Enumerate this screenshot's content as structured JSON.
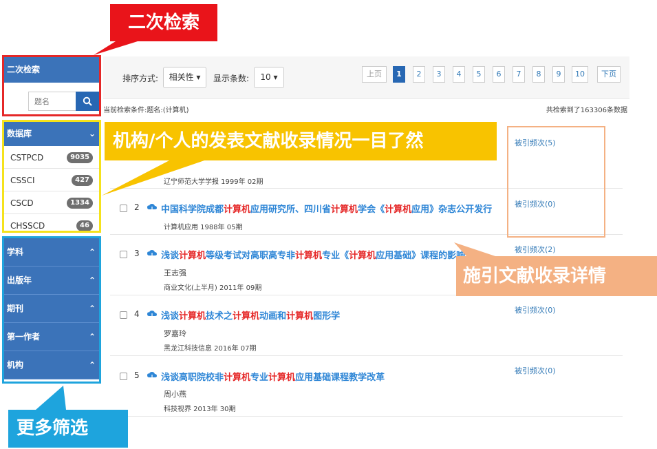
{
  "sidebar": {
    "advanced_search_title": "二次检索",
    "search_placeholder": "题名",
    "database_title": "数据库",
    "databases": [
      {
        "name": "CSTPCD",
        "count": "9035"
      },
      {
        "name": "CSSCI",
        "count": "427"
      },
      {
        "name": "CSCD",
        "count": "1334"
      },
      {
        "name": "CHSSCD",
        "count": "46"
      }
    ],
    "filters": [
      "学科",
      "出版年",
      "期刊",
      "第一作者",
      "机构"
    ]
  },
  "toolbar": {
    "sort_label": "排序方式:",
    "sort_value": "相关性",
    "display_label": "显示条数:",
    "display_value": "10",
    "prev": "上页",
    "pages": [
      "1",
      "2",
      "3",
      "4",
      "5",
      "6",
      "7",
      "8",
      "9",
      "10"
    ],
    "next": "下页"
  },
  "conditions": "当前检索条件:题名:(计算机)",
  "total": "共检索到了163306条数据",
  "results": [
    {
      "num": "",
      "title": "",
      "author": "",
      "source": "辽宁师范大学学报 1999年 02期",
      "cite": "被引频次(5)"
    },
    {
      "num": "2",
      "title_parts": [
        "中国科学院成都",
        "计算机",
        "应用研究所、四川省",
        "计算机",
        "学会《",
        "计算机",
        "应用》杂志公开发行"
      ],
      "author": "",
      "source": "计算机应用 1988年 05期",
      "cite": "被引频次(0)"
    },
    {
      "num": "3",
      "title_parts": [
        "浅谈",
        "计算机",
        "等级考试对高职高专非",
        "计算机",
        "专业《",
        "计算机",
        "应用基础》课程的影响"
      ],
      "author": "王志强",
      "source": "商业文化(上半月) 2011年 09期",
      "cite": "被引频次(2)"
    },
    {
      "num": "4",
      "title_parts": [
        "浅谈",
        "计算机",
        "技术之",
        "计算机",
        "动画和",
        "计算机",
        "图形学"
      ],
      "author": "罗嘉玲",
      "source": "黑龙江科技信息 2016年 07期",
      "cite": "被引频次(0)"
    },
    {
      "num": "5",
      "title_parts": [
        "浅谈高职院校非",
        "计算机",
        "专业",
        "计算机",
        "应用基础课程教学改革"
      ],
      "author": "周小燕",
      "source": "科技视界 2013年 30期",
      "cite": "被引频次(0)"
    }
  ],
  "annotations": {
    "secondary_search": "二次检索",
    "publication_overview": "机构/个人的发表文献收录情况一目了然",
    "citation_details": "施引文献收录详情",
    "more_filters": "更多筛选"
  },
  "colors": {
    "sidebar_blue": "#3b73b9",
    "highlight_red": "#e52727",
    "title_blue": "#2e86d6",
    "annotation_red": "#e9141a",
    "annotation_yellow": "#f8c300",
    "annotation_orange": "#f4b183",
    "annotation_blue": "#1ea4dd"
  }
}
